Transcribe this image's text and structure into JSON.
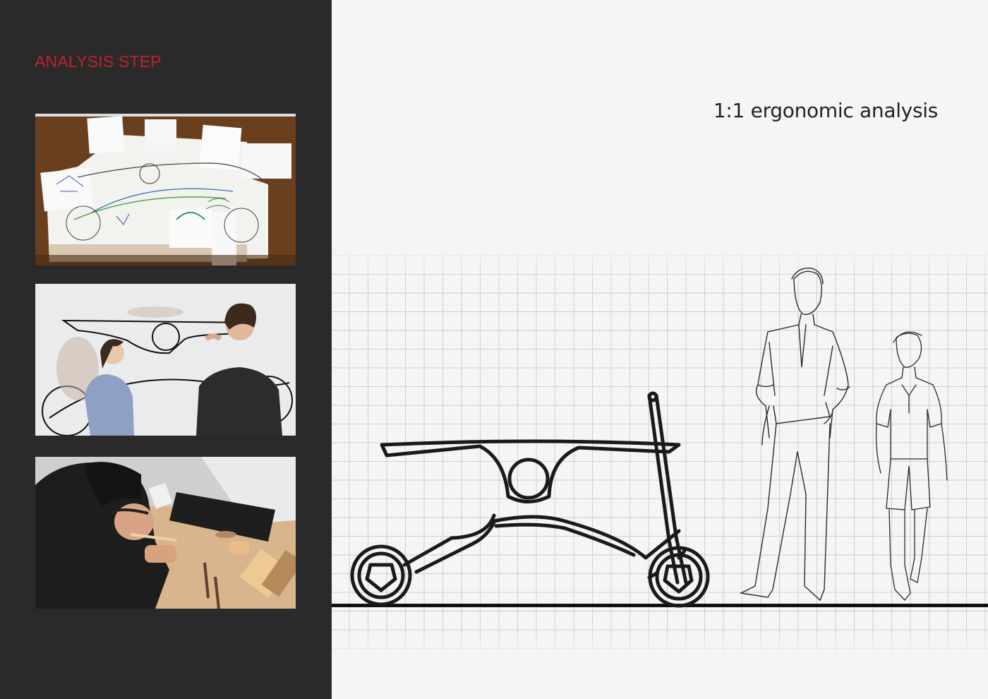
{
  "left_panel": {
    "title": "ANALYSIS STEP",
    "title_color": "#c0212a",
    "background": "#2a2a2b",
    "photos": [
      {
        "subject": "sketches pinned on a board"
      },
      {
        "subject": "two people drawing a full-scale scooter outline on a wall"
      },
      {
        "subject": "person carving a wooden model at a desk"
      }
    ]
  },
  "right_panel": {
    "title": "1:1 ergonomic analysis",
    "background": "#f5f5f5"
  },
  "drawing": {
    "grid": true,
    "subjects": [
      "scooter-outline",
      "adult-figure",
      "child-figure"
    ]
  }
}
